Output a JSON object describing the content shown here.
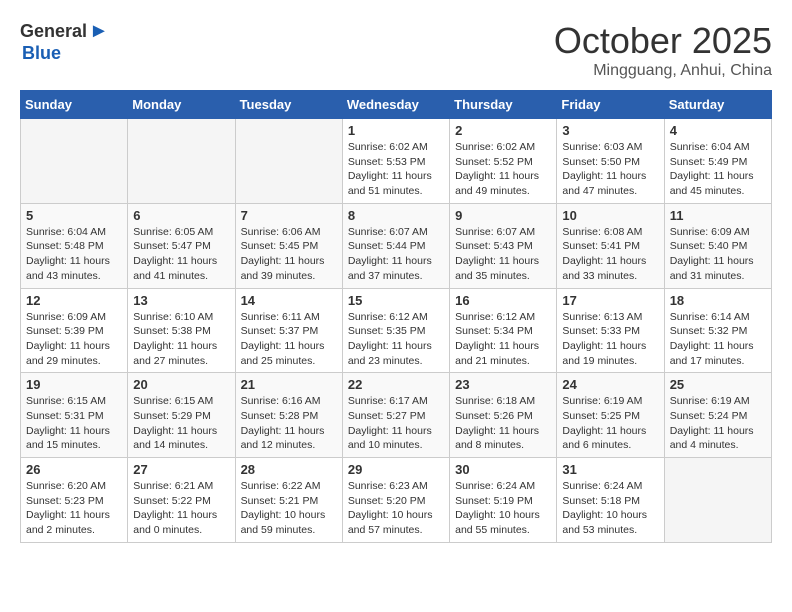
{
  "logo": {
    "general": "General",
    "blue": "Blue"
  },
  "title": "October 2025",
  "subtitle": "Mingguang, Anhui, China",
  "days_of_week": [
    "Sunday",
    "Monday",
    "Tuesday",
    "Wednesday",
    "Thursday",
    "Friday",
    "Saturday"
  ],
  "weeks": [
    [
      {
        "day": "",
        "content": ""
      },
      {
        "day": "",
        "content": ""
      },
      {
        "day": "",
        "content": ""
      },
      {
        "day": "1",
        "content": "Sunrise: 6:02 AM\nSunset: 5:53 PM\nDaylight: 11 hours and 51 minutes."
      },
      {
        "day": "2",
        "content": "Sunrise: 6:02 AM\nSunset: 5:52 PM\nDaylight: 11 hours and 49 minutes."
      },
      {
        "day": "3",
        "content": "Sunrise: 6:03 AM\nSunset: 5:50 PM\nDaylight: 11 hours and 47 minutes."
      },
      {
        "day": "4",
        "content": "Sunrise: 6:04 AM\nSunset: 5:49 PM\nDaylight: 11 hours and 45 minutes."
      }
    ],
    [
      {
        "day": "5",
        "content": "Sunrise: 6:04 AM\nSunset: 5:48 PM\nDaylight: 11 hours and 43 minutes."
      },
      {
        "day": "6",
        "content": "Sunrise: 6:05 AM\nSunset: 5:47 PM\nDaylight: 11 hours and 41 minutes."
      },
      {
        "day": "7",
        "content": "Sunrise: 6:06 AM\nSunset: 5:45 PM\nDaylight: 11 hours and 39 minutes."
      },
      {
        "day": "8",
        "content": "Sunrise: 6:07 AM\nSunset: 5:44 PM\nDaylight: 11 hours and 37 minutes."
      },
      {
        "day": "9",
        "content": "Sunrise: 6:07 AM\nSunset: 5:43 PM\nDaylight: 11 hours and 35 minutes."
      },
      {
        "day": "10",
        "content": "Sunrise: 6:08 AM\nSunset: 5:41 PM\nDaylight: 11 hours and 33 minutes."
      },
      {
        "day": "11",
        "content": "Sunrise: 6:09 AM\nSunset: 5:40 PM\nDaylight: 11 hours and 31 minutes."
      }
    ],
    [
      {
        "day": "12",
        "content": "Sunrise: 6:09 AM\nSunset: 5:39 PM\nDaylight: 11 hours and 29 minutes."
      },
      {
        "day": "13",
        "content": "Sunrise: 6:10 AM\nSunset: 5:38 PM\nDaylight: 11 hours and 27 minutes."
      },
      {
        "day": "14",
        "content": "Sunrise: 6:11 AM\nSunset: 5:37 PM\nDaylight: 11 hours and 25 minutes."
      },
      {
        "day": "15",
        "content": "Sunrise: 6:12 AM\nSunset: 5:35 PM\nDaylight: 11 hours and 23 minutes."
      },
      {
        "day": "16",
        "content": "Sunrise: 6:12 AM\nSunset: 5:34 PM\nDaylight: 11 hours and 21 minutes."
      },
      {
        "day": "17",
        "content": "Sunrise: 6:13 AM\nSunset: 5:33 PM\nDaylight: 11 hours and 19 minutes."
      },
      {
        "day": "18",
        "content": "Sunrise: 6:14 AM\nSunset: 5:32 PM\nDaylight: 11 hours and 17 minutes."
      }
    ],
    [
      {
        "day": "19",
        "content": "Sunrise: 6:15 AM\nSunset: 5:31 PM\nDaylight: 11 hours and 15 minutes."
      },
      {
        "day": "20",
        "content": "Sunrise: 6:15 AM\nSunset: 5:29 PM\nDaylight: 11 hours and 14 minutes."
      },
      {
        "day": "21",
        "content": "Sunrise: 6:16 AM\nSunset: 5:28 PM\nDaylight: 11 hours and 12 minutes."
      },
      {
        "day": "22",
        "content": "Sunrise: 6:17 AM\nSunset: 5:27 PM\nDaylight: 11 hours and 10 minutes."
      },
      {
        "day": "23",
        "content": "Sunrise: 6:18 AM\nSunset: 5:26 PM\nDaylight: 11 hours and 8 minutes."
      },
      {
        "day": "24",
        "content": "Sunrise: 6:19 AM\nSunset: 5:25 PM\nDaylight: 11 hours and 6 minutes."
      },
      {
        "day": "25",
        "content": "Sunrise: 6:19 AM\nSunset: 5:24 PM\nDaylight: 11 hours and 4 minutes."
      }
    ],
    [
      {
        "day": "26",
        "content": "Sunrise: 6:20 AM\nSunset: 5:23 PM\nDaylight: 11 hours and 2 minutes."
      },
      {
        "day": "27",
        "content": "Sunrise: 6:21 AM\nSunset: 5:22 PM\nDaylight: 11 hours and 0 minutes."
      },
      {
        "day": "28",
        "content": "Sunrise: 6:22 AM\nSunset: 5:21 PM\nDaylight: 10 hours and 59 minutes."
      },
      {
        "day": "29",
        "content": "Sunrise: 6:23 AM\nSunset: 5:20 PM\nDaylight: 10 hours and 57 minutes."
      },
      {
        "day": "30",
        "content": "Sunrise: 6:24 AM\nSunset: 5:19 PM\nDaylight: 10 hours and 55 minutes."
      },
      {
        "day": "31",
        "content": "Sunrise: 6:24 AM\nSunset: 5:18 PM\nDaylight: 10 hours and 53 minutes."
      },
      {
        "day": "",
        "content": ""
      }
    ]
  ]
}
